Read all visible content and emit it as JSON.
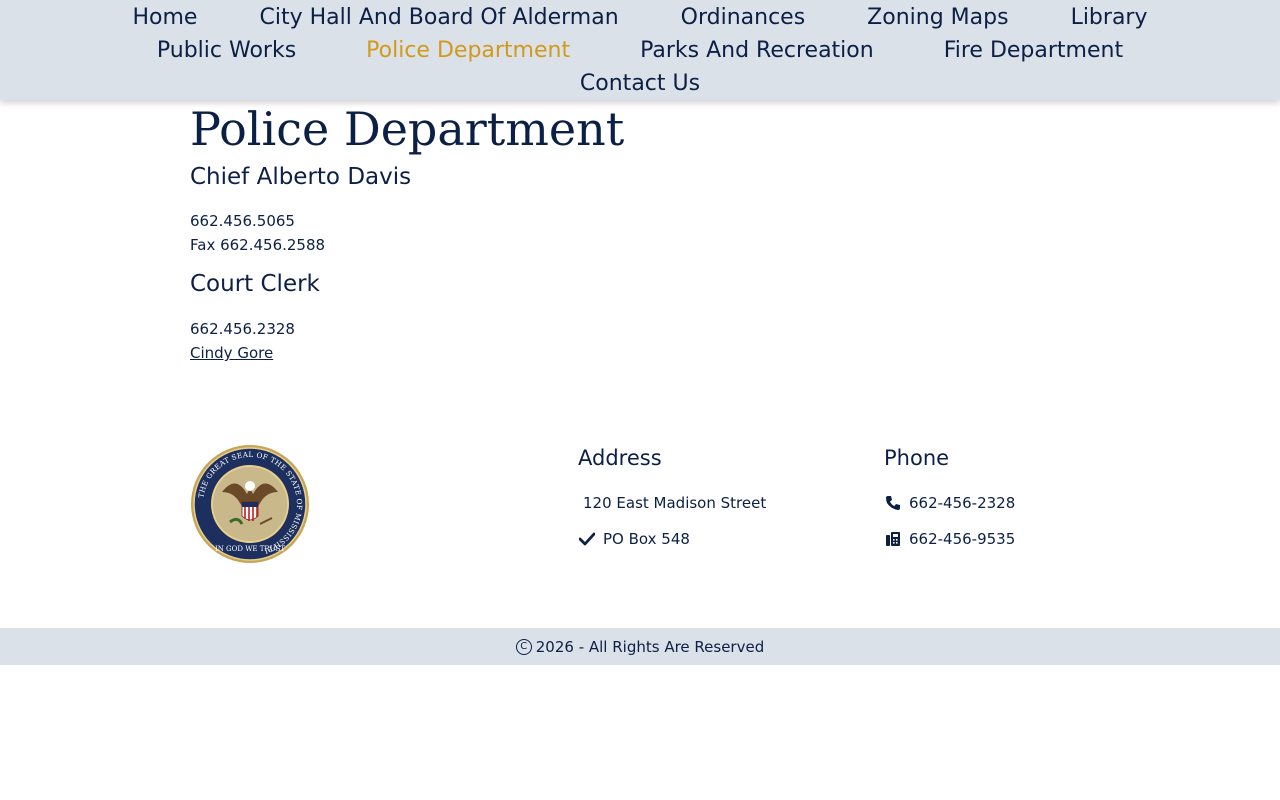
{
  "nav": {
    "row1": [
      "Home",
      "City Hall And Board Of Alderman",
      "Ordinances",
      "Zoning Maps",
      "Library"
    ],
    "row2": [
      "Public Works",
      "Police Department",
      "Parks And Recreation",
      "Fire Department"
    ],
    "row3": [
      "Contact Us"
    ],
    "active": "Police Department",
    "active_color": "#d19a1c"
  },
  "page": {
    "title": "Police Department",
    "chief": {
      "heading": "Chief Alberto Davis",
      "phone": "662.456.5065",
      "fax": "Fax 662.456.2588"
    },
    "court_clerk": {
      "heading": "Court Clerk",
      "phone": "662.456.2328",
      "name_link": "Cindy Gore"
    }
  },
  "footer": {
    "seal": {
      "ring_text": "THE GREAT SEAL OF THE STATE OF MISSISSIPPI",
      "motto": "IN GOD WE TRUST"
    },
    "address": {
      "title": "Address",
      "street": "120 East Madison Street",
      "po_box": "PO Box 548",
      "po_box_icon": "check-icon"
    },
    "phone": {
      "title": "Phone",
      "phone": "662-456-2328",
      "phone_icon": "phone-icon",
      "fax": "662-456-9535",
      "fax_icon": "fax-icon"
    },
    "copyright": "2026 - All Rights Are Reserved"
  },
  "colors": {
    "navy": "#0c1f45",
    "nav_bg": "#dbe1e8",
    "accent": "#d19a1c"
  }
}
